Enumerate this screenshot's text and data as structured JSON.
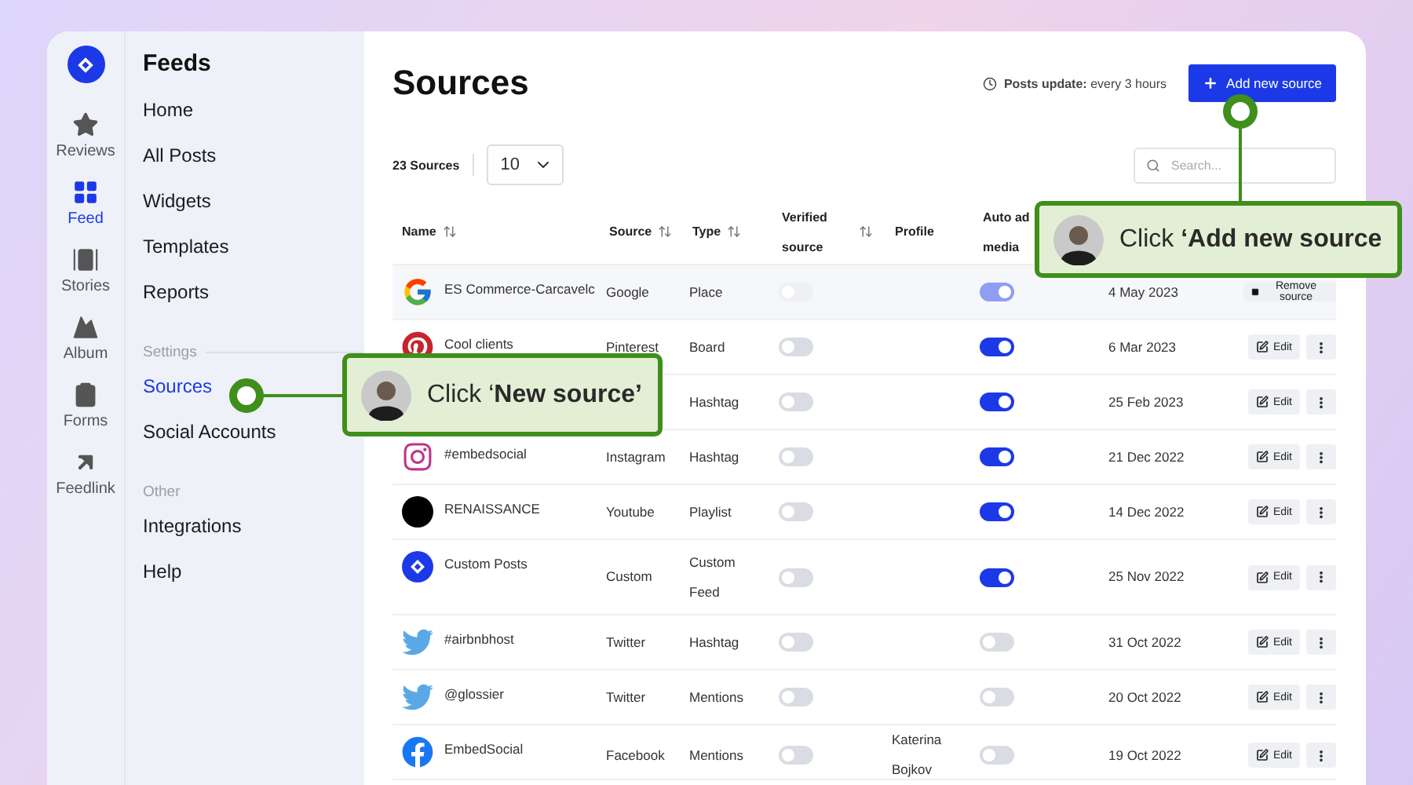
{
  "rail": {
    "items": [
      {
        "label": "Reviews",
        "selected": false
      },
      {
        "label": "Feed",
        "selected": true
      },
      {
        "label": "Stories",
        "selected": false
      },
      {
        "label": "Album",
        "selected": false
      },
      {
        "label": "Forms",
        "selected": false
      },
      {
        "label": "Feedlink",
        "selected": false
      }
    ]
  },
  "sidebar": {
    "title": "Feeds",
    "sections": [
      {
        "items": [
          {
            "label": "Home",
            "selected": false
          },
          {
            "label": "All Posts",
            "selected": false
          },
          {
            "label": "Widgets",
            "selected": false
          },
          {
            "label": "Templates",
            "selected": false
          },
          {
            "label": "Reports",
            "selected": false
          }
        ]
      },
      {
        "heading": "Settings",
        "items": [
          {
            "label": "Sources",
            "selected": true
          },
          {
            "label": "Social Accounts",
            "selected": false
          }
        ]
      },
      {
        "heading": "Other",
        "items": [
          {
            "label": "Integrations",
            "selected": false
          },
          {
            "label": "Help",
            "selected": false
          }
        ]
      }
    ]
  },
  "page": {
    "title": "Sources",
    "update_note": "**Posts update:** every 3 hours",
    "add_button": "Add new source",
    "count": "23 Sources",
    "page_size": "10",
    "search_placeholder": "Search..."
  },
  "table": {
    "columns": [
      {
        "label": "Name",
        "sortable": true
      },
      {
        "label": "Source",
        "sortable": true
      },
      {
        "label": "Type",
        "sortable": true
      },
      {
        "label": "Verified source",
        "sortable": true
      },
      {
        "label": "Profile",
        "sortable": false
      },
      {
        "label": "Auto ad media"
      }
    ],
    "rows": [
      {
        "kind": "google",
        "name": "ES Commerce-Carcavelc",
        "source": "Google",
        "type": "Place",
        "verified": false,
        "auto_ad": true,
        "disabled": true,
        "date": "4 May 2023",
        "action": {
          "kind": "remove",
          "label": "Remove source"
        }
      },
      {
        "kind": "pinterest",
        "name": "Cool clients",
        "source": "Pinterest",
        "type": "Board",
        "verified": false,
        "auto_ad": true,
        "disabled": false,
        "date": "6 Mar 2023",
        "action": {
          "kind": "edit",
          "label": "Edit"
        }
      },
      {
        "type": "Hashtag",
        "verified": false,
        "auto_ad": true,
        "disabled": false,
        "date": "25 Feb 2023",
        "action": {
          "kind": "edit",
          "label": "Edit"
        }
      },
      {
        "kind": "instagram",
        "name": "#embedsocial",
        "source": "Instagram",
        "type": "Hashtag",
        "verified": false,
        "auto_ad": true,
        "disabled": false,
        "date": "21 Dec 2022",
        "action": {
          "kind": "edit",
          "label": "Edit"
        }
      },
      {
        "kind": "youtube",
        "name": "RENAISSANCE",
        "source": "Youtube",
        "type": "Playlist",
        "verified": false,
        "auto_ad": true,
        "disabled": false,
        "date": "14 Dec 2022",
        "action": {
          "kind": "edit",
          "label": "Edit"
        }
      },
      {
        "kind": "custom",
        "name": "Custom Posts",
        "source": "Custom",
        "type": "Custom Feed",
        "verified": false,
        "auto_ad": true,
        "disabled": false,
        "date": "25 Nov 2022",
        "action": {
          "kind": "edit",
          "label": "Edit"
        }
      },
      {
        "kind": "twitter",
        "name": "#airbnbhost",
        "source": "Twitter",
        "type": "Hashtag",
        "verified": false,
        "auto_ad": false,
        "disabled": false,
        "date": "31 Oct 2022",
        "action": {
          "kind": "edit",
          "label": "Edit"
        }
      },
      {
        "kind": "twitter",
        "name": "@glossier",
        "source": "Twitter",
        "type": "Mentions",
        "verified": false,
        "auto_ad": false,
        "disabled": false,
        "date": "20 Oct 2022",
        "action": {
          "kind": "edit",
          "label": "Edit"
        }
      },
      {
        "kind": "facebook",
        "name": "EmbedSocial",
        "source": "Facebook",
        "type": "Mentions",
        "verified": false,
        "profile": "Katerina Bojkov",
        "auto_ad": false,
        "disabled": false,
        "date": "19 Oct 2022",
        "action": {
          "kind": "edit",
          "label": "Edit"
        }
      }
    ]
  },
  "callouts": [
    {
      "text": "Click **‘Add new source**"
    },
    {
      "text": "Click ‘**New source’**"
    }
  ]
}
